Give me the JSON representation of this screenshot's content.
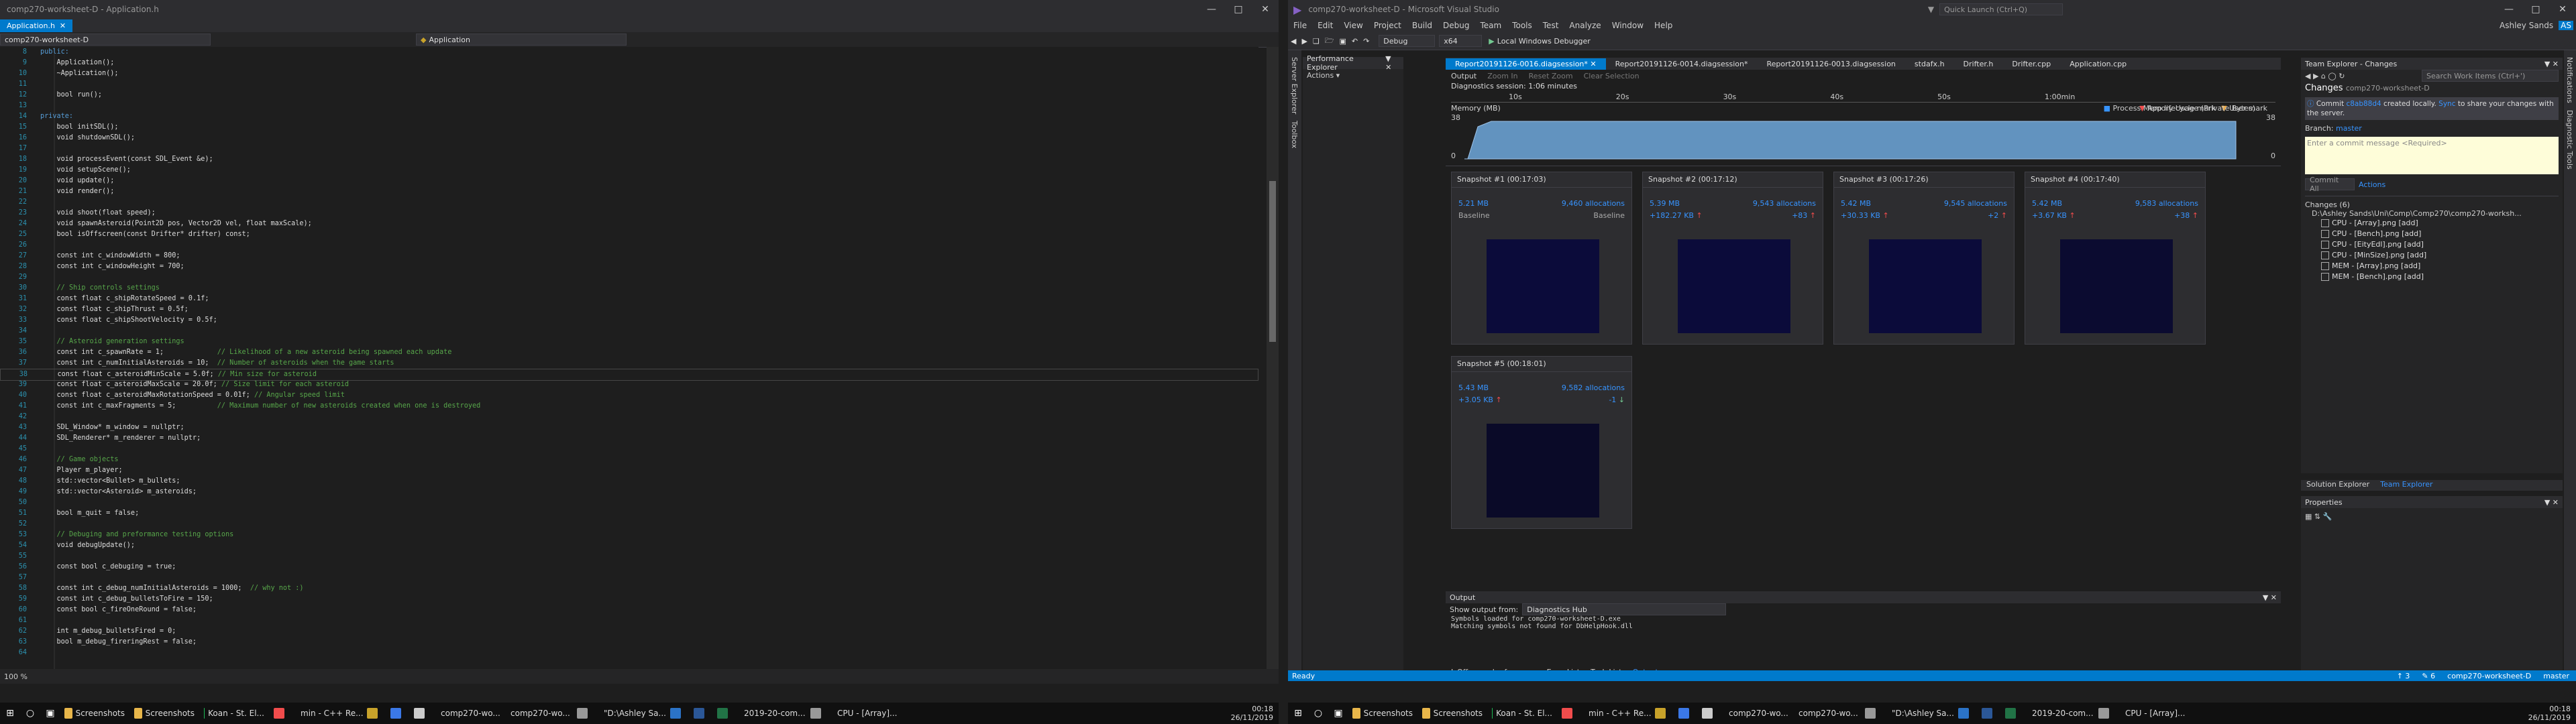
{
  "left": {
    "title": "comp270-worksheet-D - Application.h",
    "tab": "Application.h",
    "nav_project": "comp270-worksheet-D",
    "nav_scope": "Application",
    "zoom": "100 %",
    "code_lines": [
      {
        "n": "8",
        "t": "public:"
      },
      {
        "n": "9",
        "t": "    Application();"
      },
      {
        "n": "10",
        "t": "    ~Application();"
      },
      {
        "n": "11",
        "t": ""
      },
      {
        "n": "12",
        "t": "    bool run();"
      },
      {
        "n": "13",
        "t": ""
      },
      {
        "n": "14",
        "t": "private:"
      },
      {
        "n": "15",
        "t": "    bool initSDL();"
      },
      {
        "n": "16",
        "t": "    void shutdownSDL();"
      },
      {
        "n": "17",
        "t": ""
      },
      {
        "n": "18",
        "t": "    void processEvent(const SDL_Event &e);"
      },
      {
        "n": "19",
        "t": "    void setupScene();"
      },
      {
        "n": "20",
        "t": "    void update();"
      },
      {
        "n": "21",
        "t": "    void render();"
      },
      {
        "n": "22",
        "t": ""
      },
      {
        "n": "23",
        "t": "    void shoot(float speed);"
      },
      {
        "n": "24",
        "t": "    void spawnAsteroid(Point2D pos, Vector2D vel, float maxScale);"
      },
      {
        "n": "25",
        "t": "    bool isOffscreen(const Drifter* drifter) const;"
      },
      {
        "n": "26",
        "t": ""
      },
      {
        "n": "27",
        "t": "    const int c_windowWidth = 800;"
      },
      {
        "n": "28",
        "t": "    const int c_windowHeight = 700;"
      },
      {
        "n": "29",
        "t": ""
      },
      {
        "n": "30",
        "t": "    // Ship controls settings"
      },
      {
        "n": "31",
        "t": "    const float c_shipRotateSpeed = 0.1f;"
      },
      {
        "n": "32",
        "t": "    const float c_shipThrust = 0.5f;"
      },
      {
        "n": "33",
        "t": "    const float c_shipShootVelocity = 0.5f;"
      },
      {
        "n": "34",
        "t": ""
      },
      {
        "n": "35",
        "t": "    // Asteroid generation settings"
      },
      {
        "n": "36",
        "t": "    const int c_spawnRate = 1;             // Likelihood of a new asteroid being spawned each update"
      },
      {
        "n": "37",
        "t": "    const int c_numInitialAsteroids = 10;  // Number of asteroids when the game starts"
      },
      {
        "n": "38",
        "t": "    const float c_asteroidMinScale = 5.0f; // Min size for asteroid"
      },
      {
        "n": "39",
        "t": "    const float c_asteroidMaxScale = 20.0f; // Size limit for each asteroid"
      },
      {
        "n": "40",
        "t": "    const float c_asteroidMaxRotationSpeed = 0.01f; // Angular speed limit"
      },
      {
        "n": "41",
        "t": "    const int c_maxFragments = 5;          // Maximum number of new asteroids created when one is destroyed"
      },
      {
        "n": "42",
        "t": ""
      },
      {
        "n": "43",
        "t": "    SDL_Window* m_window = nullptr;"
      },
      {
        "n": "44",
        "t": "    SDL_Renderer* m_renderer = nullptr;"
      },
      {
        "n": "45",
        "t": ""
      },
      {
        "n": "46",
        "t": "    // Game objects"
      },
      {
        "n": "47",
        "t": "    Player m_player;"
      },
      {
        "n": "48",
        "t": "    std::vector<Bullet> m_bullets;"
      },
      {
        "n": "49",
        "t": "    std::vector<Asteroid> m_asteroids;"
      },
      {
        "n": "50",
        "t": ""
      },
      {
        "n": "51",
        "t": "    bool m_quit = false;"
      },
      {
        "n": "52",
        "t": ""
      },
      {
        "n": "53",
        "t": "    // Debuging and preformance testing options"
      },
      {
        "n": "54",
        "t": "    void debugUpdate();"
      },
      {
        "n": "55",
        "t": ""
      },
      {
        "n": "56",
        "t": "    const bool c_debuging = true;"
      },
      {
        "n": "57",
        "t": ""
      },
      {
        "n": "58",
        "t": "    const int c_debug_numInitialAsteroids = 1000;  // why not :)"
      },
      {
        "n": "59",
        "t": "    const int c_debug_bulletsToFire = 150;"
      },
      {
        "n": "60",
        "t": "    const bool c_fireOneRound = false;"
      },
      {
        "n": "61",
        "t": ""
      },
      {
        "n": "62",
        "t": "    int m_debug_bulletsFired = 0;"
      },
      {
        "n": "63",
        "t": "    bool m_debug_fireringRest = false;"
      },
      {
        "n": "64",
        "t": ""
      }
    ]
  },
  "right": {
    "title": "comp270-worksheet-D - Microsoft Visual Studio",
    "quick_launch": "Quick Launch (Ctrl+Q)",
    "user": "Ashley Sands",
    "user_initials": "AS",
    "menu": [
      "File",
      "Edit",
      "View",
      "Project",
      "Build",
      "Debug",
      "Team",
      "Tools",
      "Test",
      "Analyze",
      "Window",
      "Help"
    ],
    "toolbar": {
      "config": "Debug",
      "platform": "x64",
      "run": "Local Windows Debugger"
    },
    "perf_explorer": "Performance Explorer",
    "actions": "Actions",
    "server_explorer": "Server Explorer",
    "toolbox": "Toolbox",
    "diag_tabs": [
      "Report20191126-0016.diagsession*",
      "Report20191126-0014.diagsession*",
      "Report20191126-0013.diagsession",
      "stdafx.h",
      "Drifter.h",
      "Drifter.cpp",
      "Application.cpp"
    ],
    "diag_toolbar": [
      "Output",
      "Zoom In",
      "Reset Zoom",
      "Clear Selection"
    ],
    "session": "Diagnostics session: 1:06 minutes",
    "ticks": [
      "10s",
      "20s",
      "30s",
      "40s",
      "50s",
      "1:00min"
    ],
    "memory_title": "Memory (MB)",
    "memory_scale": {
      "top": "38",
      "bottom": "0"
    },
    "legend": {
      "lifecycle": "App lifecycle mark",
      "usermark": "User mark",
      "process": "Process Memory Usage (Private Bytes)"
    },
    "snapshots": [
      {
        "title": "Snapshot #1",
        "time": "(00:17:03)",
        "size": "5.21 MB",
        "allocs": "9,460 allocations",
        "s2": "Baseline",
        "a2": "Baseline"
      },
      {
        "title": "Snapshot #2",
        "time": "(00:17:12)",
        "size": "5.39 MB",
        "allocs": "9,543 allocations",
        "s2": "+182.27 KB",
        "a2": "+83"
      },
      {
        "title": "Snapshot #3",
        "time": "(00:17:26)",
        "size": "5.42 MB",
        "allocs": "9,545 allocations",
        "s2": "+30.33 KB",
        "a2": "+2"
      },
      {
        "title": "Snapshot #4",
        "time": "(00:17:40)",
        "size": "5.42 MB",
        "allocs": "9,583 allocations",
        "s2": "+3.67 KB",
        "a2": "+38"
      },
      {
        "title": "Snapshot #5",
        "time": "(00:18:01)",
        "size": "5.43 MB",
        "allocs": "9,582 allocations",
        "s2": "+3.05 KB",
        "a2": "-1"
      }
    ],
    "output": {
      "title": "Output",
      "show_from": "Show output from:",
      "source": "Diagnostics Hub",
      "lines": [
        "Symbols loaded for comp270-worksheet-D.exe",
        "Matching symbols not found for DbHelpHook.dll"
      ],
      "bottom_tabs": [
        "IsOffscreen' references",
        "Error List",
        "Task List",
        "Output"
      ]
    },
    "team_explorer": {
      "title": "Team Explorer - Changes",
      "search": "Search Work Items (Ctrl+')",
      "header": "Changes",
      "repo": "comp270-worksheet-D",
      "commit_msg_a": "Commit",
      "commit_hash": "c8ab88d4",
      "commit_msg_b": "created locally.",
      "sync": "Sync",
      "commit_msg_c": "to share your changes with the server.",
      "branch_label": "Branch:",
      "branch": "master",
      "message_placeholder": "Enter a commit message <Required>",
      "commit_all": "Commit All",
      "actions": "Actions",
      "changes_count": "Changes (6)",
      "path": "D:\\Ashley Sands\\Uni\\Comp\\Comp270\\comp270-worksh...",
      "files": [
        "CPU - [Array].png [add]",
        "CPU - [Bench].png [add]",
        "CPU - [EityEdl].png [add]",
        "CPU - [MinSize].png [add]",
        "MEM - [Array].png [add]",
        "MEM - [Bench].png [add]"
      ],
      "bottom_tabs": [
        "Solution Explorer",
        "Team Explorer"
      ]
    },
    "properties": "Properties",
    "notifications": "Notifications",
    "diagnostic_tools": "Diagnostic Tools",
    "status_ready": "Ready",
    "status_right": [
      "↑ 3",
      "✎ 6",
      "comp270-worksheet-D",
      "master"
    ]
  },
  "taskbar_left": [
    {
      "label": "Screenshots",
      "c": "#e8b64a"
    },
    {
      "label": "Screenshots",
      "c": "#e8b64a"
    },
    {
      "label": "Koan - St. El...",
      "c": "#1db954"
    },
    {
      "label": "",
      "c": "#f14c4c"
    },
    {
      "label": "min - C++ Re...",
      "c": "#4285f4"
    },
    {
      "label": "",
      "c": "#c8a22a"
    },
    {
      "label": "",
      "c": "#3b78e7"
    },
    {
      "label": "",
      "c": "#ccc"
    },
    {
      "label": "comp270-wo...",
      "c": "#8661c5"
    },
    {
      "label": "comp270-wo...",
      "c": "#8661c5"
    },
    {
      "label": "",
      "c": "#999"
    },
    {
      "label": "\"D:\\Ashley Sa...",
      "c": "#ccc"
    },
    {
      "label": "",
      "c": "#2b73c7"
    },
    {
      "label": "",
      "c": "#2b5797"
    },
    {
      "label": "",
      "c": "#217346"
    },
    {
      "label": "2019-20-com...",
      "c": "#d24726"
    },
    {
      "label": "",
      "c": "#999"
    },
    {
      "label": "CPU - [Array]...",
      "c": "#ccc"
    }
  ],
  "clock": {
    "time": "00:18",
    "date": "26/11/2019"
  }
}
